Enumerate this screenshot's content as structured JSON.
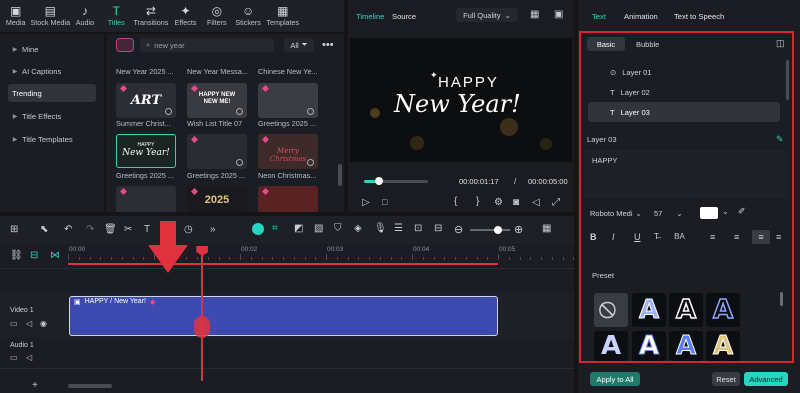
{
  "toolbar": {
    "items": [
      {
        "label": "Media",
        "icon": "media-icon",
        "g": "▣"
      },
      {
        "label": "Stock Media",
        "icon": "stock-media-icon",
        "g": "▤"
      },
      {
        "label": "Audio",
        "icon": "audio-icon",
        "g": "♪"
      },
      {
        "label": "Titles",
        "icon": "titles-icon",
        "g": "T"
      },
      {
        "label": "Transitions",
        "icon": "transitions-icon",
        "g": "⇄"
      },
      {
        "label": "Effects",
        "icon": "effects-icon",
        "g": "✦"
      },
      {
        "label": "Filters",
        "icon": "filters-icon",
        "g": "◎"
      },
      {
        "label": "Stickers",
        "icon": "stickers-icon",
        "g": "☺"
      },
      {
        "label": "Templates",
        "icon": "templates-icon",
        "g": "▦"
      }
    ],
    "active": "Titles"
  },
  "sidebar": {
    "items": [
      "Mine",
      "AI Captions",
      "Trending",
      "Title Effects",
      "Title Templates"
    ],
    "selected": "Trending"
  },
  "library": {
    "search_placeholder": "new year",
    "filter_label": "All",
    "row0": [
      "New Year 2025 ...",
      "New Year Messa...",
      "Chinese New Ye..."
    ],
    "row1": [
      "Summer Christ...",
      "Wish List Title 07",
      "Greetings 2025 ..."
    ],
    "row2": [
      "Greetings 2025 ...",
      "Greetings 2025 ...",
      "Neon Christmas..."
    ],
    "thumb_texts": {
      "art": "ART",
      "wish": "HAPPY NEW NEW ME!",
      "greet_happy": "HAPPY",
      "greet_new": "New Year!",
      "year2025": "2025",
      "merry": "Merry Christmas"
    }
  },
  "preview": {
    "tab_timeline": "Timeline",
    "tab_source": "Source",
    "quality": "Full Quality",
    "happy": "HAPPY",
    "newyear": "New Year!",
    "current_time": "00:00:01:17",
    "separator": "/",
    "total_time": "00:00:05:00",
    "progress": 0.23
  },
  "timeline": {
    "ruler": [
      "00:00",
      "00:01",
      "00:02",
      "00:03",
      "00:04",
      "00:05"
    ],
    "clip_label": "HAPPY / New Year!",
    "track_video": "Video 1",
    "track_audio": "Audio 1",
    "playhead_fraction": 0.31
  },
  "right": {
    "tabs": [
      "Text",
      "Animation",
      "Text to Speech"
    ],
    "active_tab": "Text",
    "sub_basic": "Basic",
    "sub_bubble": "Bubble",
    "layers": [
      "Layer 01",
      "Layer 02",
      "Layer 03"
    ],
    "selected_layer": "Layer 03",
    "layer_heading": "Layer 03",
    "text_content": "HAPPY",
    "font": "Roboto Medi",
    "font_size": "57",
    "preset_label": "Preset",
    "apply_all": "Apply to All",
    "reset": "Reset",
    "advanced": "Advanced"
  },
  "colors": {
    "accent": "#26d6c0",
    "red": "#e0323e",
    "clip": "#3d4bb0"
  }
}
